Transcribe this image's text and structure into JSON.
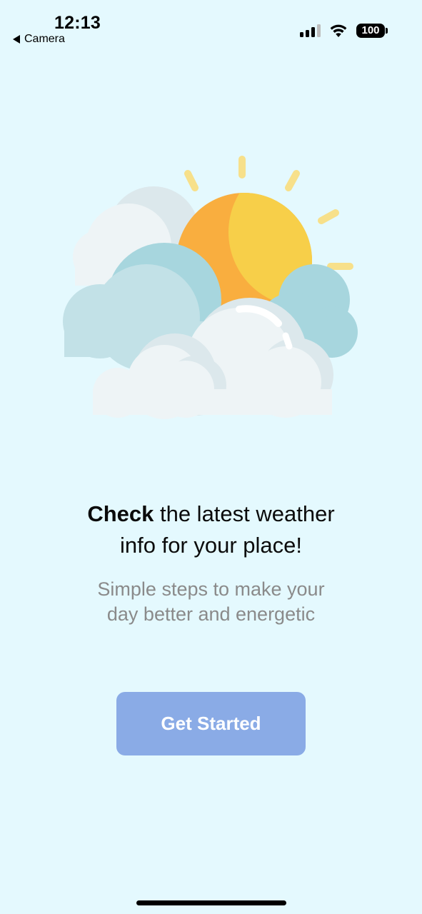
{
  "status_bar": {
    "time": "12:13",
    "back_app": "Camera",
    "battery": "100"
  },
  "illustration": {
    "icon": "sun-behind-clouds-icon",
    "colors": {
      "sun_dark": "#F9AE3F",
      "sun_light": "#F7CF49",
      "ray": "#F7E08A",
      "cloud_blue": "#A7D6DE",
      "cloud_light": "#EEF4F6",
      "cloud_shade": "#D7E5EA"
    }
  },
  "content": {
    "headline_bold": "Check",
    "headline_rest": " the latest weather",
    "headline_line2": "info for your place!",
    "subtext_line1": "Simple steps to make your",
    "subtext_line2": "day better and energetic",
    "cta_label": "Get Started"
  },
  "colors": {
    "background": "#E4F9FE",
    "button": "#8AABE6",
    "subtext": "#8A8A8A"
  }
}
